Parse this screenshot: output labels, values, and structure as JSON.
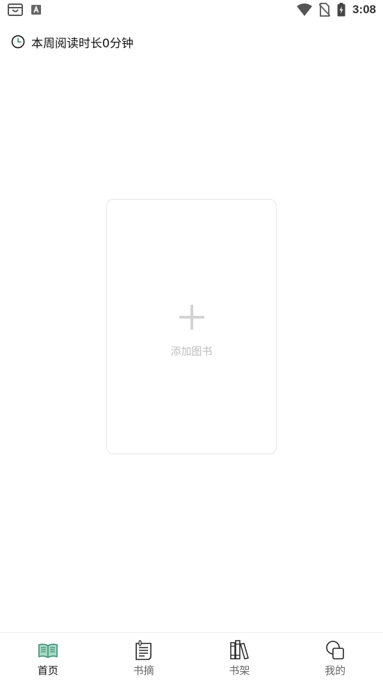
{
  "status_bar": {
    "time": "3:08",
    "left_icons": [
      "store-bag-icon",
      "text-a-icon"
    ],
    "right_icons": [
      "wifi-icon",
      "no-sim-icon",
      "battery-icon"
    ]
  },
  "reading": {
    "icon": "clock-icon",
    "text": "本周阅读时长0分钟"
  },
  "add_book": {
    "icon": "plus-icon",
    "label": "添加图书"
  },
  "nav": {
    "accent": "#3a8f74",
    "items": [
      {
        "label": "首页",
        "icon": "open-book-icon",
        "active": true
      },
      {
        "label": "书摘",
        "icon": "notepad-icon",
        "active": false
      },
      {
        "label": "书架",
        "icon": "bookshelf-icon",
        "active": false
      },
      {
        "label": "我的",
        "icon": "profile-shapes-icon",
        "active": false
      }
    ]
  }
}
